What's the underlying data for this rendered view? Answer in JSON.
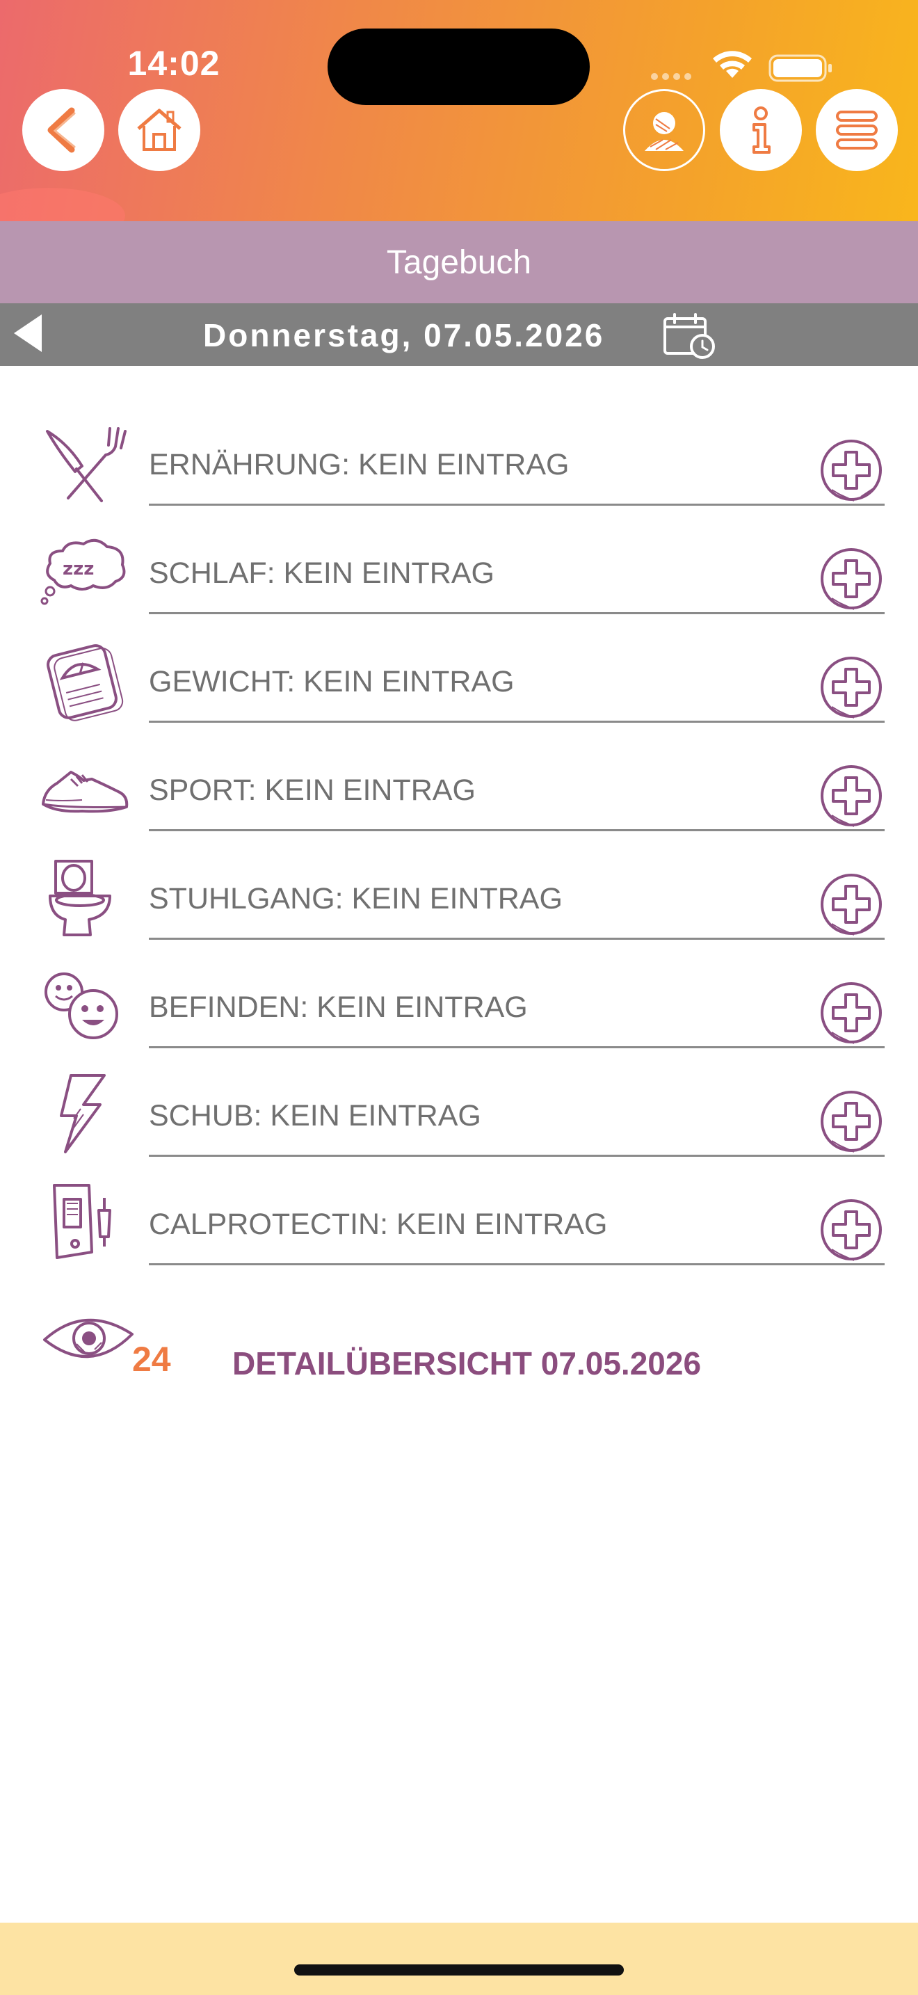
{
  "status_bar": {
    "time": "14:02"
  },
  "nav": {
    "back_icon": "chevron-left-icon",
    "home_icon": "house-icon",
    "profile_icon": "user-icon",
    "info_icon": "info-icon",
    "menu_icon": "hamburger-menu-icon"
  },
  "page": {
    "title": "Tagebuch"
  },
  "date_bar": {
    "label": "Donnerstag, 07.05.2026",
    "calendar_icon": "calendar-clock-icon"
  },
  "entries": [
    {
      "label": "ERNÄHRUNG: KEIN EINTRAG",
      "icon": "fork-knife-icon"
    },
    {
      "label": "SCHLAF: KEIN EINTRAG",
      "icon": "sleep-cloud-icon"
    },
    {
      "label": "GEWICHT: KEIN EINTRAG",
      "icon": "scale-icon"
    },
    {
      "label": "SPORT: KEIN EINTRAG",
      "icon": "sneaker-icon"
    },
    {
      "label": "STUHLGANG: KEIN EINTRAG",
      "icon": "toilet-icon"
    },
    {
      "label": "BEFINDEN: KEIN EINTRAG",
      "icon": "smileys-icon"
    },
    {
      "label": "SCHUB: KEIN EINTRAG",
      "icon": "lightning-icon"
    },
    {
      "label": "CALPROTECTIN: KEIN EINTRAG",
      "icon": "test-kit-icon"
    }
  ],
  "detail": {
    "count": "24",
    "label": "DETAILÜBERSICHT 07.05.2026",
    "icon": "eye-icon"
  },
  "colors": {
    "accent_purple": "#8b4d7e",
    "icon_purple": "#8a4f82",
    "orange": "#ef7b43",
    "title_bar": "#b896b0",
    "date_bar": "#808080",
    "footer": "#fde3a3"
  }
}
